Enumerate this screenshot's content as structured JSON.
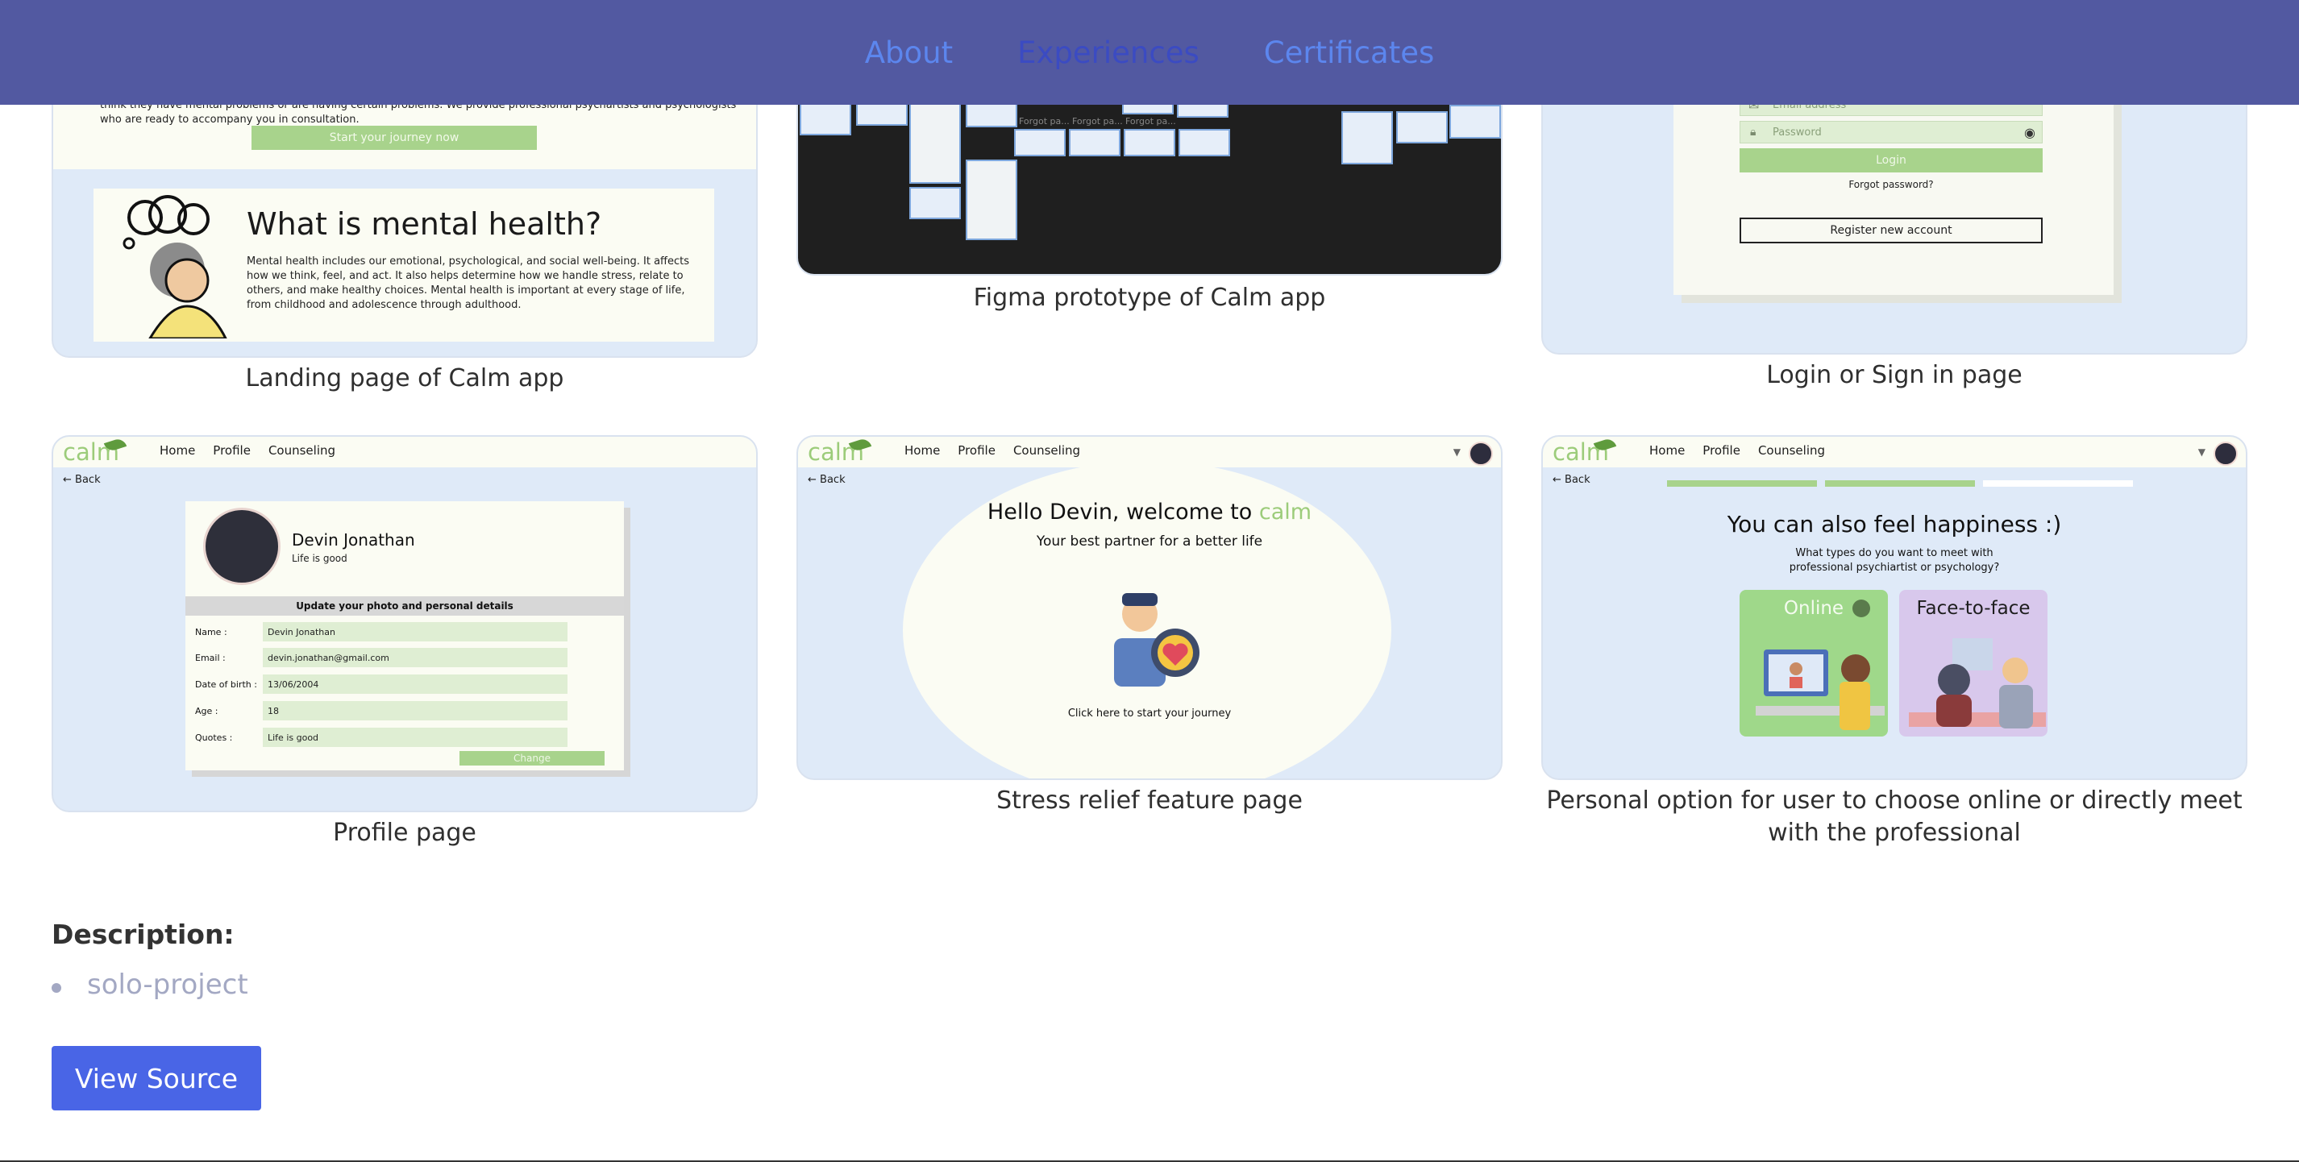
{
  "nav": {
    "about": "About",
    "experiences": "Experiences",
    "certificates": "Certificates"
  },
  "gallery": {
    "landing": {
      "caption": "Landing page of Calm app",
      "intro": "\"calm\" is a web-based platform that provides a paid consultation to users from children, adolescents, or adults who have or think they have mental problems or are having certain problems. We provide professional psychartists and psychologists who are ready to accompany you in consultation.",
      "cta": "Start your journey now",
      "heading": "What is mental health?",
      "body": "Mental health includes our emotional, psychological, and social well-being. It affects how we think, feel, and act. It also helps determine how we handle stress, relate to others, and make healthy choices. Mental health is important at every stage of life, from childhood and adolescence through adulthood."
    },
    "figma": {
      "caption": "Figma prototype of Calm app",
      "frame_labels": [
        "Forgot pa...",
        "Forgot pa...",
        "Forgot pa..."
      ]
    },
    "login": {
      "caption": "Login or Sign in page",
      "email_placeholder": "Email address",
      "password_placeholder": "Password",
      "login_button": "Login",
      "forgot": "Forgot password?",
      "register": "Register new account"
    },
    "profile": {
      "caption": "Profile page",
      "logo": "calm",
      "nav": [
        "Home",
        "Profile",
        "Counseling"
      ],
      "back": "Back",
      "name": "Devin Jonathan",
      "quote": "Life is good",
      "section_title": "Update your photo and personal details",
      "fields": [
        {
          "label": "Name :",
          "value": "Devin Jonathan"
        },
        {
          "label": "Email :",
          "value": "devin.jonathan@gmail.com"
        },
        {
          "label": "Date of birth :",
          "value": "13/06/2004"
        },
        {
          "label": "Age :",
          "value": "18"
        },
        {
          "label": "Quotes :",
          "value": "Life is good"
        }
      ],
      "change_button": "Change"
    },
    "stress": {
      "caption": "Stress relief feature page",
      "logo": "calm",
      "nav": [
        "Home",
        "Profile",
        "Counseling"
      ],
      "back": "Back",
      "heading": "Hello Devin, welcome to",
      "heading_logo": "calm",
      "subtitle": "Your best partner for a better life",
      "cta": "Click here to start your journey"
    },
    "options": {
      "caption": "Personal option for user to choose online or directly meet with the professional",
      "logo": "calm",
      "nav": [
        "Home",
        "Profile",
        "Counseling"
      ],
      "back": "Back",
      "progress": 0.67,
      "heading": "You can also feel happiness :)",
      "question": "What types do you want to meet with professional psychiartist or psychology?",
      "online_label": "Online",
      "f2f_label": "Face-to-face"
    }
  },
  "description": {
    "label": "Description:",
    "items": [
      "solo-project"
    ]
  },
  "view_source": "View Source",
  "colors": {
    "navbar": "#5259a1",
    "nav_link": "#5c86ee",
    "accent_button": "#4965e6",
    "calm_green": "#a8d38c",
    "app_bg": "#dfeaf8"
  }
}
